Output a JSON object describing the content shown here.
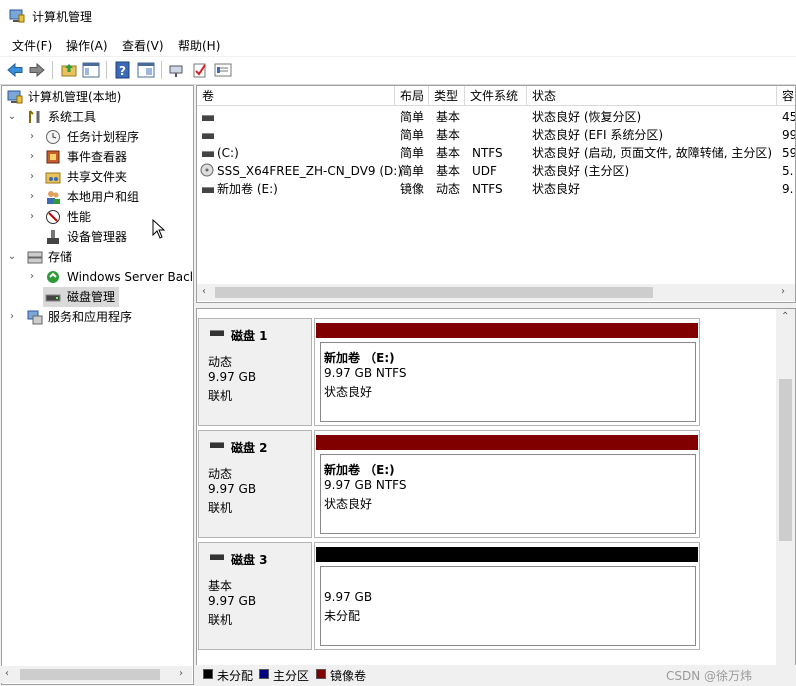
{
  "window": {
    "title": "计算机管理"
  },
  "menu": {
    "items": [
      "文件(F)",
      "操作(A)",
      "查看(V)",
      "帮助(H)"
    ]
  },
  "toolbar": {
    "buttons": [
      "back-icon",
      "forward-icon",
      "up-folder-icon",
      "show-hide-tree-icon",
      "help-icon",
      "properties-icon",
      "console-icon",
      "check-icon",
      "list-icon"
    ]
  },
  "tree": {
    "root": "计算机管理(本地)",
    "system_tools": "系统工具",
    "task_scheduler": "任务计划程序",
    "event_viewer": "事件查看器",
    "shared_folders": "共享文件夹",
    "local_users": "本地用户和组",
    "performance": "性能",
    "device_manager": "设备管理器",
    "storage": "存储",
    "wsb": "Windows Server Back",
    "disk_mgmt": "磁盘管理",
    "services": "服务和应用程序"
  },
  "volumes": {
    "columns": [
      "卷",
      "布局",
      "类型",
      "文件系统",
      "状态",
      "容"
    ],
    "rows": [
      {
        "volume": "",
        "layout": "简单",
        "type": "基本",
        "fs": "",
        "status": "状态良好 (恢复分区)",
        "cap": "45"
      },
      {
        "volume": "",
        "layout": "简单",
        "type": "基本",
        "fs": "",
        "status": "状态良好 (EFI 系统分区)",
        "cap": "99"
      },
      {
        "volume": "(C:)",
        "layout": "简单",
        "type": "基本",
        "fs": "NTFS",
        "status": "状态良好 (启动, 页面文件, 故障转储, 主分区)",
        "cap": "59"
      },
      {
        "volume": "SSS_X64FREE_ZH-CN_DV9 (D:)",
        "layout": "简单",
        "type": "基本",
        "fs": "UDF",
        "status": "状态良好 (主分区)",
        "cap": "5."
      },
      {
        "volume": "新加卷 (E:)",
        "layout": "镜像",
        "type": "动态",
        "fs": "NTFS",
        "status": "状态良好",
        "cap": "9."
      }
    ]
  },
  "disks": [
    {
      "name": "磁盘 1",
      "kind": "动态",
      "size": "9.97 GB",
      "state": "联机",
      "bar_color": "#800000",
      "p_name": "新加卷 （E:)",
      "p_size": "9.97 GB NTFS",
      "p_status": "状态良好"
    },
    {
      "name": "磁盘 2",
      "kind": "动态",
      "size": "9.97 GB",
      "state": "联机",
      "bar_color": "#800000",
      "p_name": "新加卷 （E:)",
      "p_size": "9.97 GB NTFS",
      "p_status": "状态良好"
    },
    {
      "name": "磁盘 3",
      "kind": "基本",
      "size": "9.97 GB",
      "state": "联机",
      "bar_color": "#000000",
      "p_name": "",
      "p_size": "9.97 GB",
      "p_status": "未分配"
    }
  ],
  "legend": {
    "unallocated": "未分配",
    "unallocated_color": "#000000",
    "primary": "主分区",
    "primary_color": "#000080",
    "mirror": "镜像卷",
    "mirror_color": "#800000"
  },
  "watermark": "CSDN @徐万炜"
}
